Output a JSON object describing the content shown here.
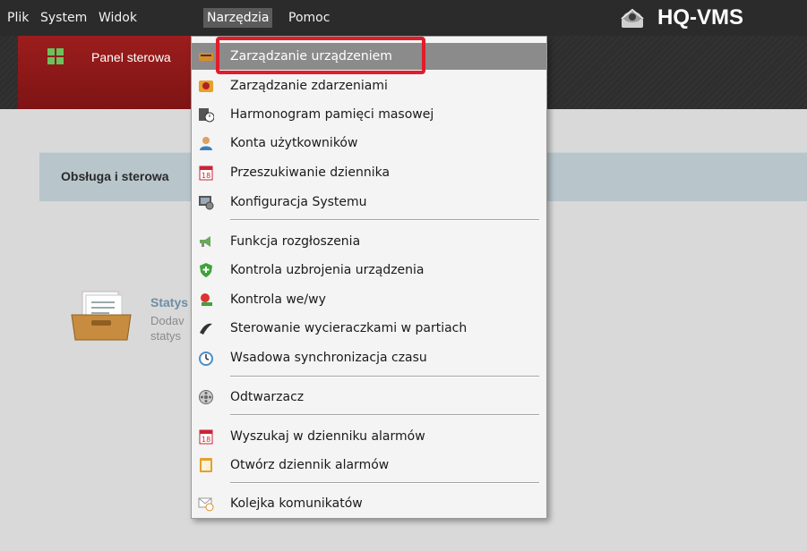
{
  "menubar": {
    "items": [
      "Plik",
      "System",
      "Widok",
      "Narzędzia",
      "Pomoc"
    ],
    "active_index": 3,
    "brand": "HQ-VMS"
  },
  "toolbar": {
    "tab_label": "Panel sterowa"
  },
  "content": {
    "section_title": "Obsługa i sterowa",
    "card_title": "Statys",
    "card_desc_line1": "Dodav",
    "card_desc_line2": "statys"
  },
  "dropdown": {
    "items": [
      {
        "label": "Zarządzanie urządzeniem",
        "icon": "device-management-icon"
      },
      {
        "label": "Zarządzanie zdarzeniami",
        "icon": "event-management-icon"
      },
      {
        "label": "Harmonogram pamięci masowej",
        "icon": "storage-schedule-icon"
      },
      {
        "label": "Konta użytkowników",
        "icon": "user-accounts-icon"
      },
      {
        "label": "Przeszukiwanie dziennika",
        "icon": "log-search-icon"
      },
      {
        "label": "Konfiguracja Systemu",
        "icon": "system-config-icon"
      },
      {
        "label": "Funkcja rozgłoszenia",
        "icon": "broadcast-icon"
      },
      {
        "label": "Kontrola uzbrojenia urządzenia",
        "icon": "arming-control-icon"
      },
      {
        "label": "Kontrola we/wy",
        "icon": "io-control-icon"
      },
      {
        "label": "Sterowanie wycieraczkami w partiach",
        "icon": "wiper-control-icon"
      },
      {
        "label": "Wsadowa synchronizacja czasu",
        "icon": "time-sync-icon"
      },
      {
        "label": "Odtwarzacz",
        "icon": "player-icon"
      },
      {
        "label": "Wyszukaj w dzienniku alarmów",
        "icon": "alarm-log-search-icon"
      },
      {
        "label": "Otwórz dziennik alarmów",
        "icon": "open-alarm-log-icon"
      },
      {
        "label": "Kolejka komunikatów",
        "icon": "message-queue-icon"
      }
    ],
    "hovered_index": 0
  },
  "colors": {
    "highlight_border": "#e01d2a",
    "active_tab": "#9c1d1d"
  }
}
